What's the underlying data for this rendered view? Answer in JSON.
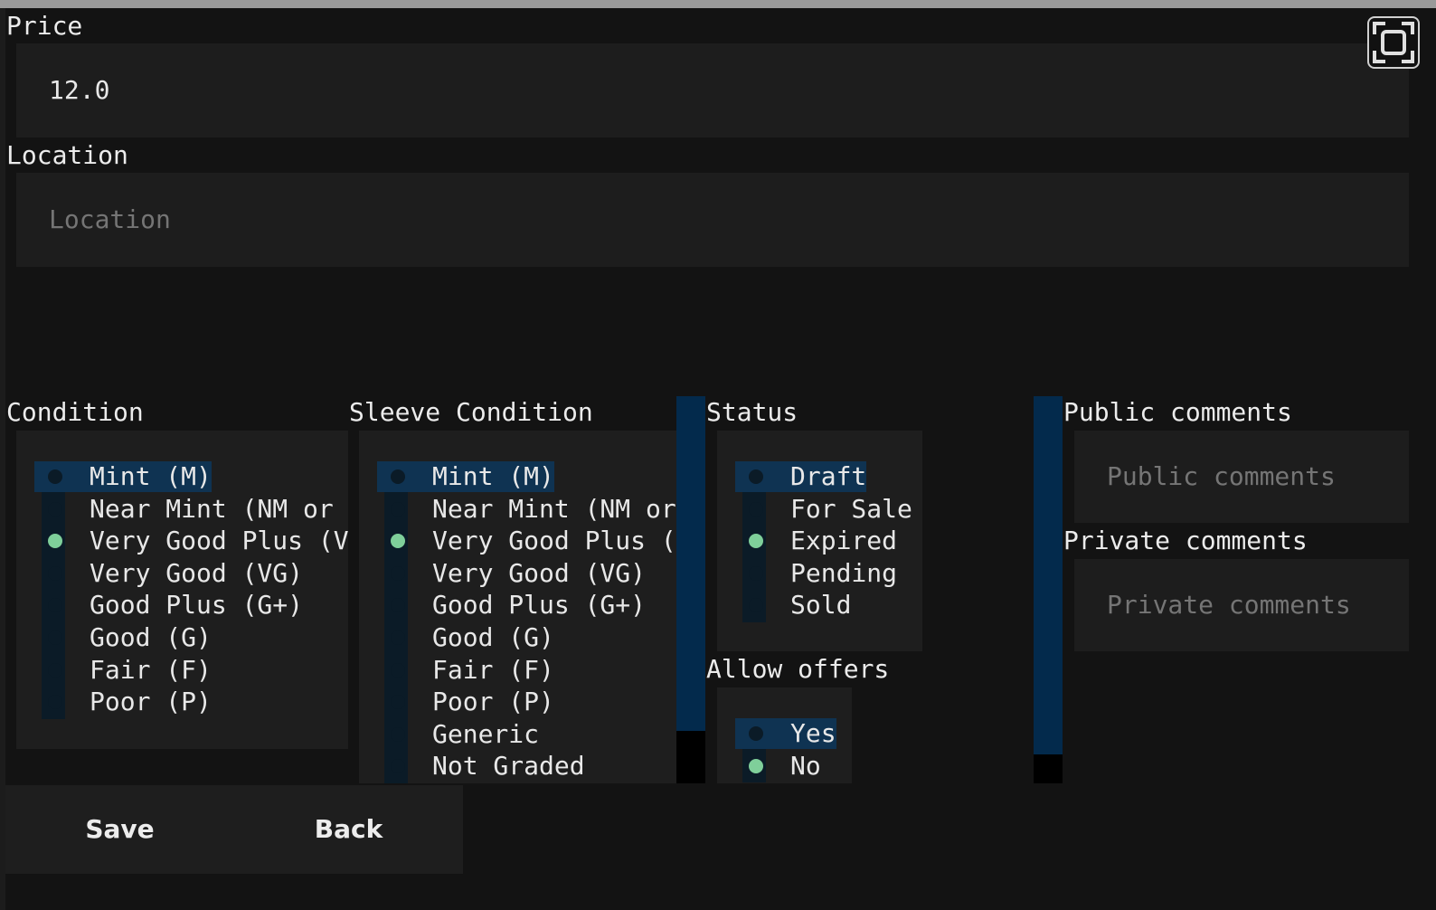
{
  "price": {
    "label": "Price",
    "value": "12.0"
  },
  "location": {
    "label": "Location",
    "placeholder": "Location"
  },
  "condition": {
    "label": "Condition",
    "options": [
      "Mint (M)",
      "Near Mint (NM or M",
      "Very Good Plus (VG",
      "Very Good (VG)",
      "Good Plus (G+)",
      "Good (G)",
      "Fair (F)",
      "Poor (P)"
    ],
    "highlighted": "Mint (M)",
    "selected": "Very Good Plus (VG"
  },
  "sleeve_condition": {
    "label": "Sleeve Condition",
    "options": [
      "Mint (M)",
      "Near Mint (NM or",
      "Very Good Plus (V",
      "Very Good (VG)",
      "Good Plus (G+)",
      "Good (G)",
      "Fair (F)",
      "Poor (P)",
      "Generic",
      "Not Graded"
    ],
    "highlighted": "Mint (M)",
    "selected": "Very Good Plus (V"
  },
  "status": {
    "label": "Status",
    "options": [
      "Draft",
      "For Sale",
      "Expired",
      "Pending",
      "Sold"
    ],
    "highlighted": "Draft",
    "selected": "Expired"
  },
  "allow_offers": {
    "label": "Allow offers",
    "options": [
      "Yes",
      "No"
    ],
    "highlighted": "Yes",
    "selected": "No"
  },
  "public_comments": {
    "label": "Public comments",
    "placeholder": "Public comments"
  },
  "private_comments": {
    "label": "Private comments",
    "placeholder": "Private comments"
  },
  "buttons": {
    "save": "Save",
    "back": "Back"
  },
  "icons": {
    "fullscreen": "fullscreen-icon"
  },
  "colors": {
    "background": "#131313",
    "field": "#1d1d1d",
    "highlight": "#0f3352",
    "selected_bullet": "#7fcf9a",
    "scrollbar_thumb": "#032a4c"
  }
}
